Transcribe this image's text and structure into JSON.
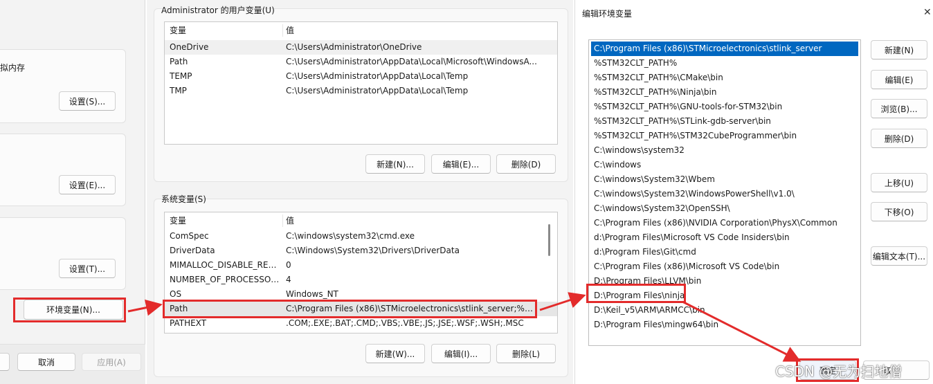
{
  "left_window": {
    "label_virtual_memory": "拟内存",
    "btn_settings_s": "设置(S)...",
    "btn_settings_e": "设置(E)...",
    "btn_settings_t": "设置(T)...",
    "btn_env_vars": "环境变量(N)...",
    "btn_cancel": "取消",
    "btn_apply": "应用(A)"
  },
  "env_window": {
    "user_section_title": "Administrator 的用户变量(U)",
    "system_section_title": "系统变量(S)",
    "col_variable": "变量",
    "col_value": "值",
    "user_vars": [
      {
        "name": "OneDrive",
        "value": "C:\\Users\\Administrator\\OneDrive"
      },
      {
        "name": "Path",
        "value": "C:\\Users\\Administrator\\AppData\\Local\\Microsoft\\WindowsA..."
      },
      {
        "name": "TEMP",
        "value": "C:\\Users\\Administrator\\AppData\\Local\\Temp"
      },
      {
        "name": "TMP",
        "value": "C:\\Users\\Administrator\\AppData\\Local\\Temp"
      }
    ],
    "system_vars": [
      {
        "name": "ComSpec",
        "value": "C:\\windows\\system32\\cmd.exe"
      },
      {
        "name": "DriverData",
        "value": "C:\\Windows\\System32\\Drivers\\DriverData"
      },
      {
        "name": "MIMALLOC_DISABLE_RED...",
        "value": "0"
      },
      {
        "name": "NUMBER_OF_PROCESSORS",
        "value": "4"
      },
      {
        "name": "OS",
        "value": "Windows_NT"
      },
      {
        "name": "Path",
        "value": "C:\\Program Files (x86)\\STMicroelectronics\\stlink_server;%ST..."
      },
      {
        "name": "PATHEXT",
        "value": ".COM;.EXE;.BAT;.CMD;.VBS;.VBE;.JS;.JSE;.WSF;.WSH;.MSC"
      }
    ],
    "user_buttons": {
      "new": "新建(N)...",
      "edit": "编辑(E)...",
      "delete": "删除(D)"
    },
    "system_buttons": {
      "new": "新建(W)...",
      "edit": "编辑(I)...",
      "delete": "删除(L)"
    }
  },
  "edit_window": {
    "title": "编辑环境变量",
    "close_glyph": "✕",
    "entries": [
      "C:\\Program Files (x86)\\STMicroelectronics\\stlink_server",
      "%STM32CLT_PATH%",
      "%STM32CLT_PATH%\\CMake\\bin",
      "%STM32CLT_PATH%\\Ninja\\bin",
      "%STM32CLT_PATH%\\GNU-tools-for-STM32\\bin",
      "%STM32CLT_PATH%\\STLink-gdb-server\\bin",
      "%STM32CLT_PATH%\\STM32CubeProgrammer\\bin",
      "C:\\windows\\system32",
      "C:\\windows",
      "C:\\windows\\System32\\Wbem",
      "C:\\windows\\System32\\WindowsPowerShell\\v1.0\\",
      "C:\\windows\\System32\\OpenSSH\\",
      "C:\\Program Files (x86)\\NVIDIA Corporation\\PhysX\\Common",
      "d:\\Program Files\\Microsoft VS Code Insiders\\bin",
      "d:\\Program Files\\Git\\cmd",
      "C:\\Program Files (x86)\\Microsoft VS Code\\bin",
      "D:\\Program Files\\LLVM\\bin",
      "D:\\Program Files\\ninja",
      "D:\\Keil_v5\\ARM\\ARMCC\\bin",
      "D:\\Program Files\\mingw64\\bin"
    ],
    "btn_new": "新建(N)",
    "btn_edit": "编辑(E)",
    "btn_browse": "浏览(B)...",
    "btn_delete": "删除(D)",
    "btn_up": "上移(U)",
    "btn_down": "下移(O)",
    "btn_edit_text": "编辑文本(T)...",
    "btn_ok": "确定",
    "btn_cancel_partial": "取"
  },
  "watermark": "CSDN @无为扫地僧",
  "colors": {
    "highlight": "#e32b2b",
    "selection": "#0067c0"
  }
}
